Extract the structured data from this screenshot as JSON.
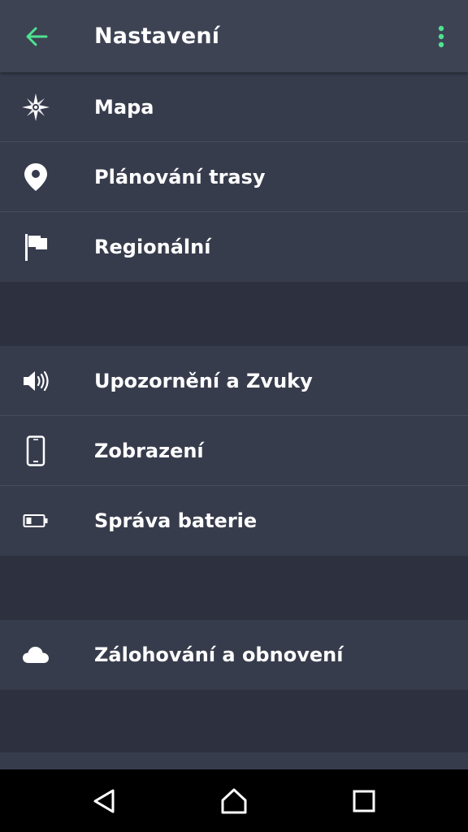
{
  "header": {
    "title": "Nastavení",
    "back_icon": "arrow-left-icon",
    "more_icon": "more-vertical-icon",
    "accent_color": "#4ee38f"
  },
  "groups": [
    {
      "items": [
        {
          "label": "Mapa",
          "icon": "compass-rose-icon"
        },
        {
          "label": "Plánování trasy",
          "icon": "location-pin-icon"
        },
        {
          "label": "Regionální",
          "icon": "flag-icon"
        }
      ]
    },
    {
      "items": [
        {
          "label": "Upozornění a Zvuky",
          "icon": "speaker-icon"
        },
        {
          "label": "Zobrazení",
          "icon": "smartphone-icon"
        },
        {
          "label": "Správa baterie",
          "icon": "battery-icon"
        }
      ]
    },
    {
      "items": [
        {
          "label": "Zálohování a obnovení",
          "icon": "cloud-icon"
        }
      ]
    }
  ],
  "navbar": {
    "buttons": [
      "back-nav-icon",
      "home-nav-icon",
      "recents-nav-icon"
    ]
  }
}
